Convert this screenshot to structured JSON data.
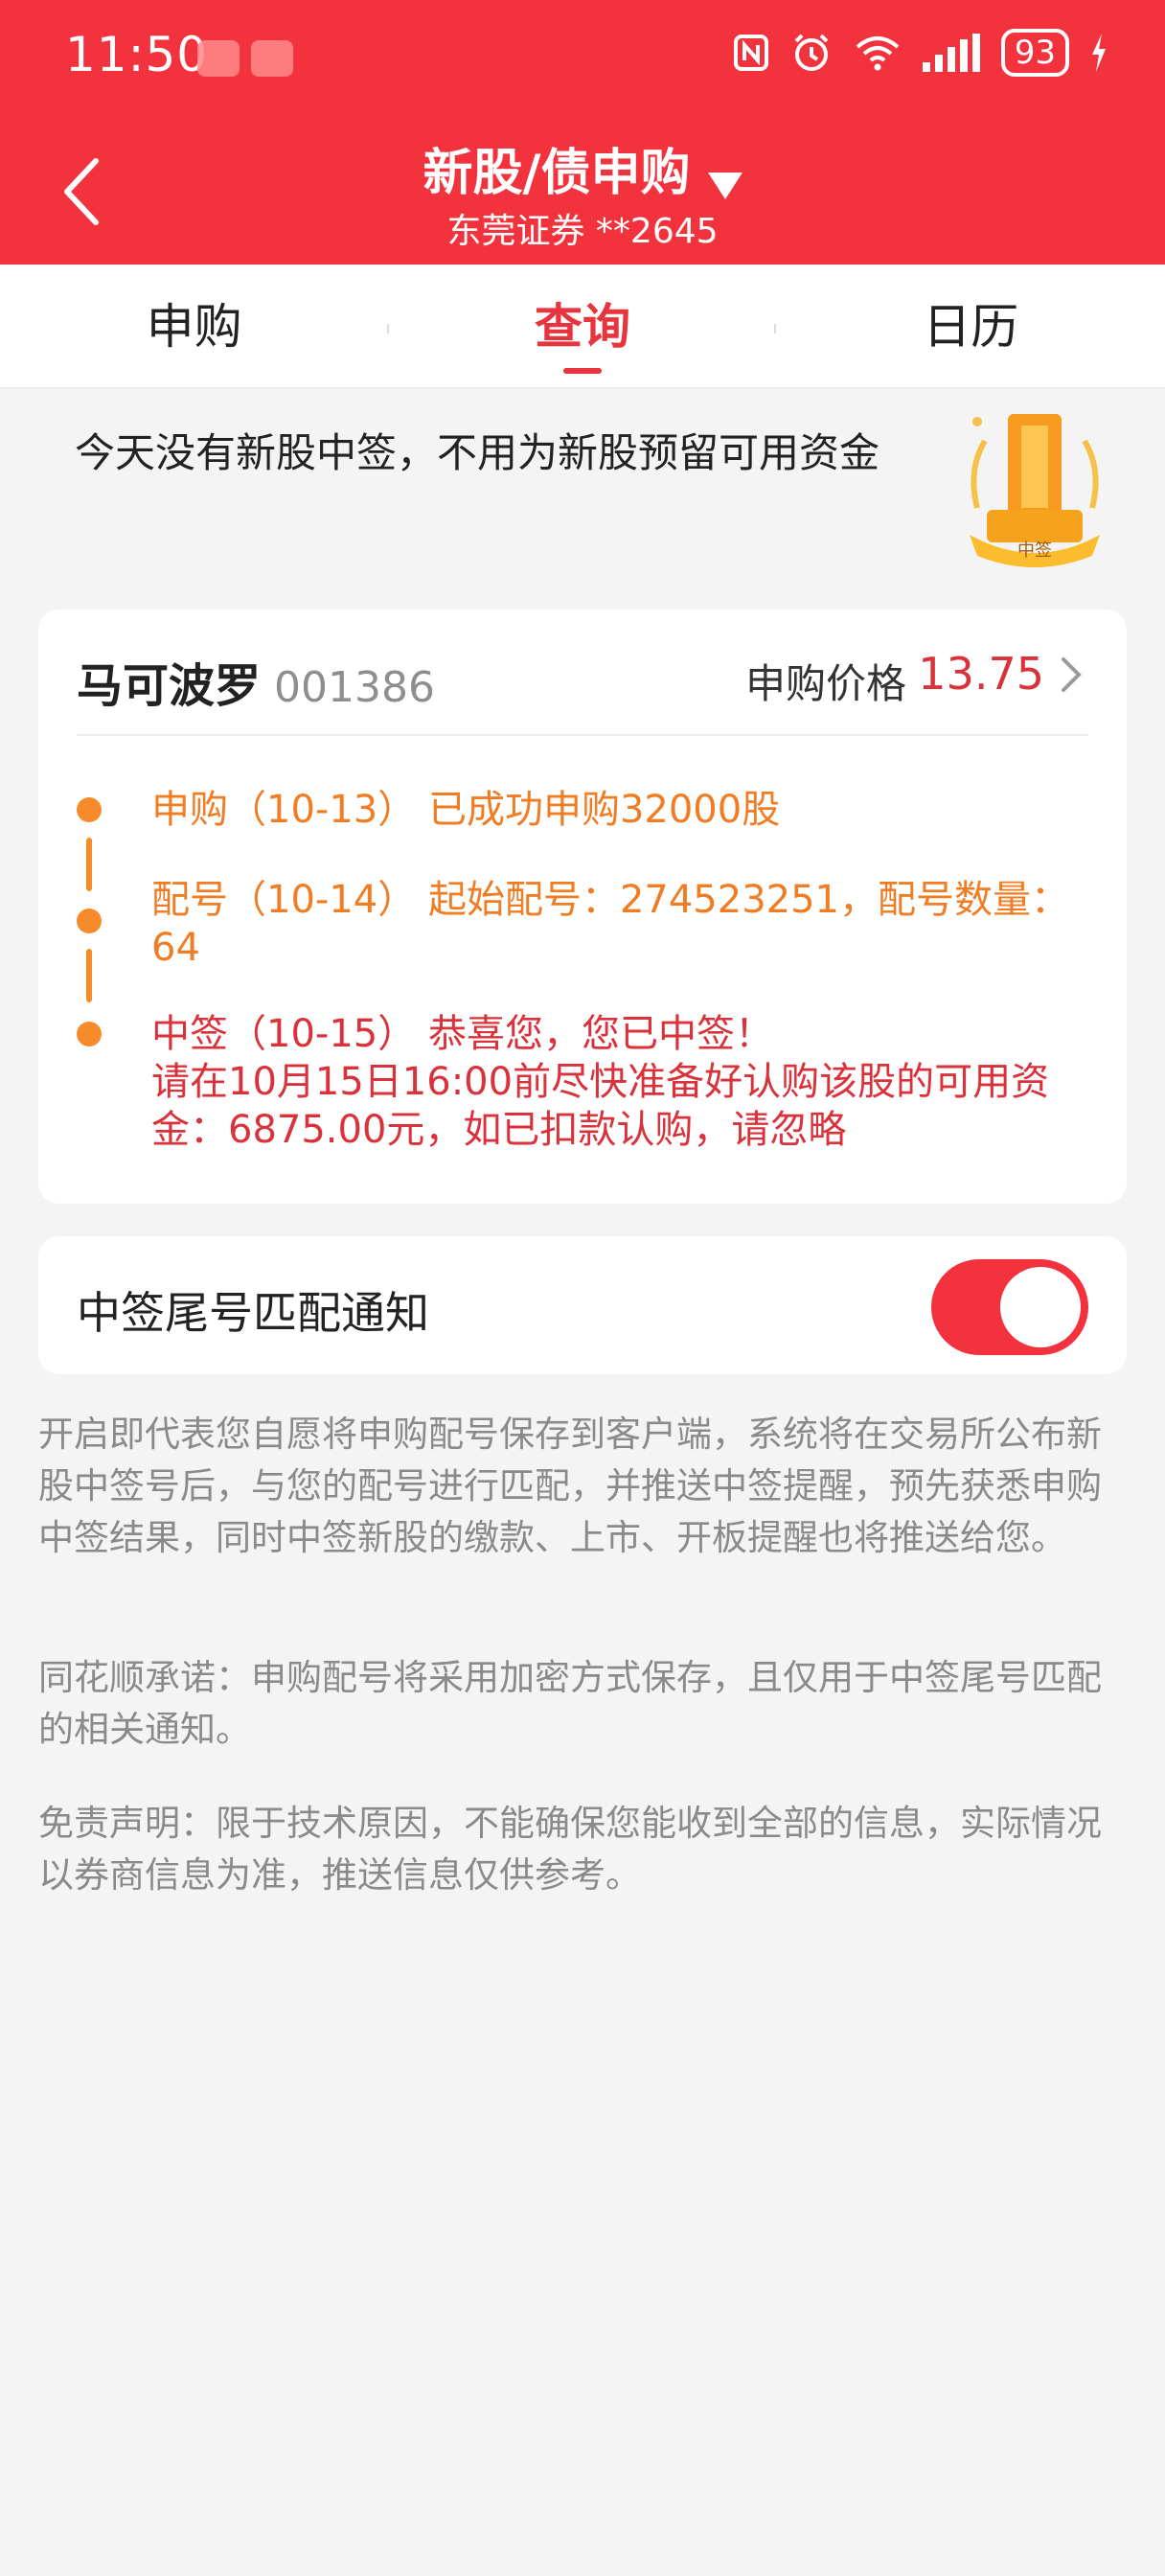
{
  "status_bar": {
    "time": "11:50",
    "battery": "93"
  },
  "header": {
    "title": "新股/债申购",
    "subtitle": "东莞证券 **2645"
  },
  "tabs": [
    {
      "label": "申购",
      "active": false
    },
    {
      "label": "查询",
      "active": true
    },
    {
      "label": "日历",
      "active": false
    }
  ],
  "notice": {
    "text": "今天没有新股中签，不用为新股预留可用资金",
    "badge_label": "中签"
  },
  "stock_card": {
    "name": "马可波罗",
    "code": "001386",
    "price_label": "申购价格",
    "price": "13.75",
    "timeline": [
      {
        "text": "申购（10-13） 已成功申购32000股"
      },
      {
        "text": "配号（10-14） 起始配号：274523251，配号数量：64"
      },
      {
        "text": "中签（10-15） 恭喜您，您已中签！"
      },
      {
        "text": "请在10月15日16:00前尽快准备好认购该股的可用资金：6875.00元，如已扣款认购，请忽略"
      }
    ]
  },
  "notify": {
    "label": "中签尾号匹配通知",
    "enabled": true
  },
  "descriptions": [
    "开启即代表您自愿将申购配号保存到客户端，系统将在交易所公布新股中签号后，与您的配号进行匹配，并推送中签提醒，预先获悉申购中签结果，同时中签新股的缴款、上市、开板提醒也将推送给您。",
    "同花顺承诺：申购配号将采用加密方式保存，且仅用于中签尾号匹配的相关通知。",
    "免责声明：限于技术原因，不能确保您能收到全部的信息，实际情况以券商信息为准，推送信息仅供参考。"
  ],
  "colors": {
    "brand_red": "#f2323c",
    "timeline_orange": "#f07d24",
    "alert_red": "#d9323a"
  }
}
